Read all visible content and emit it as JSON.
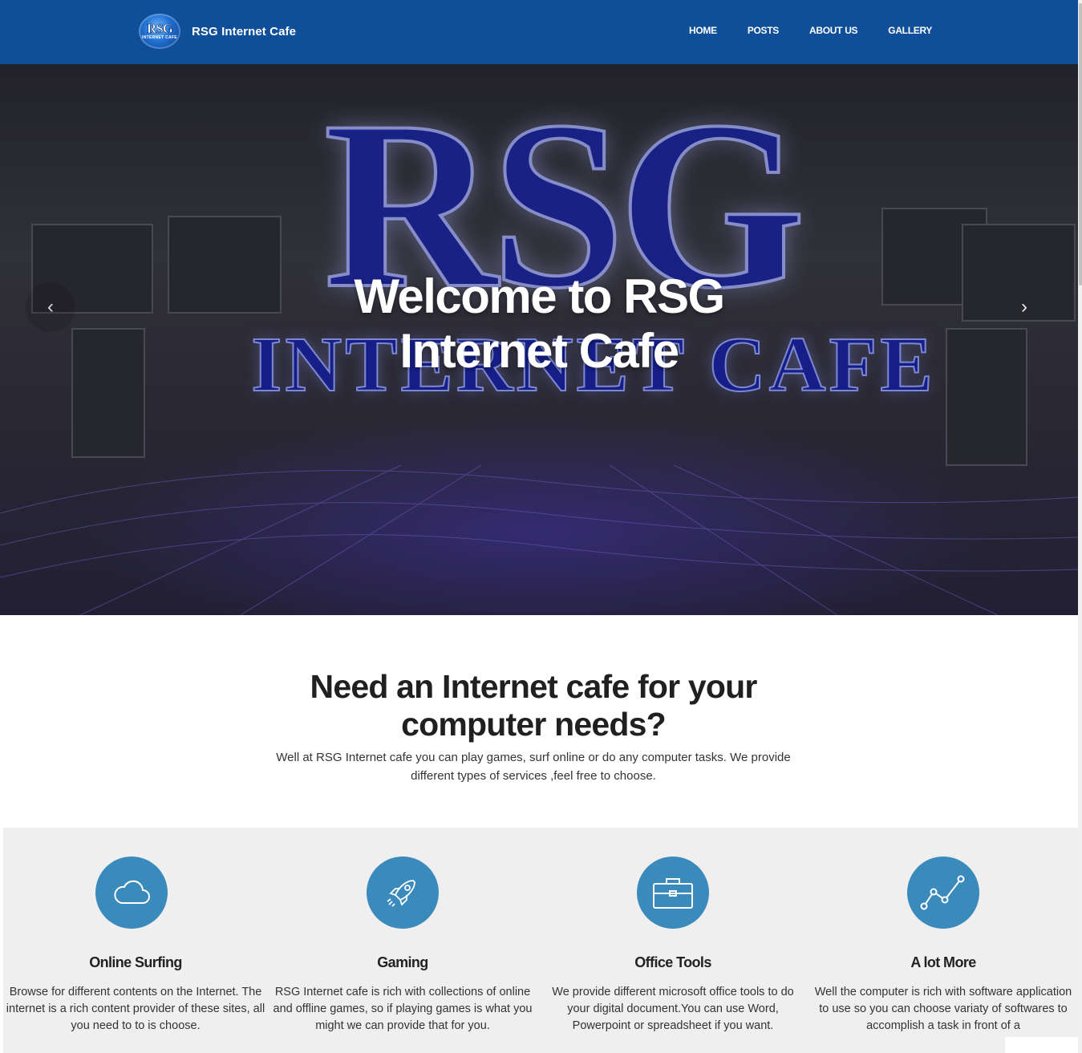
{
  "brand": {
    "logo_text": "RSG",
    "logo_subtext": "INTERNET CAFE",
    "name": "RSG Internet Cafe"
  },
  "nav": {
    "items": [
      {
        "label": "HOME"
      },
      {
        "label": "POSTS"
      },
      {
        "label": "ABOUT US"
      },
      {
        "label": "GALLERY"
      }
    ]
  },
  "hero": {
    "image_logo_text": "RSG",
    "image_logo_subtext": "INTERNET CAFE",
    "title_line1": "Welcome to RSG",
    "title_line2": "Internet Cafe",
    "prev_icon": "chevron-left-icon",
    "next_icon": "chevron-right-icon",
    "prev_glyph": "‹",
    "next_glyph": "›"
  },
  "intro": {
    "title_line1": "Need an Internet cafe for your",
    "title_line2": "computer needs?",
    "text": "Well at RSG Internet cafe you can play games, surf online or do any computer tasks. We provide different types of services ,feel free to choose."
  },
  "services": [
    {
      "icon": "cloud-icon",
      "title": "Online Surfing",
      "desc": "Browse for different contents on the Internet. The internet is a rich content provider of these sites, all you need to to is choose."
    },
    {
      "icon": "rocket-icon",
      "title": "Gaming",
      "desc": "RSG Internet cafe is rich with collections of online and offline games, so if playing games is what you might we can provide that for you."
    },
    {
      "icon": "briefcase-icon",
      "title": "Office Tools",
      "desc": "We provide different microsoft office tools to do your digital document.You can use Word, Powerpoint or spreadsheet if you want."
    },
    {
      "icon": "line-chart-icon",
      "title": "A lot More",
      "desc": "Well the computer is rich with software application to use so you can choose variaty of softwares to accomplish a task in front of a"
    }
  ],
  "colors": {
    "navbar": "#0f4f9a",
    "service_icon_bg": "#3a8abb",
    "services_bg": "#efefef"
  }
}
